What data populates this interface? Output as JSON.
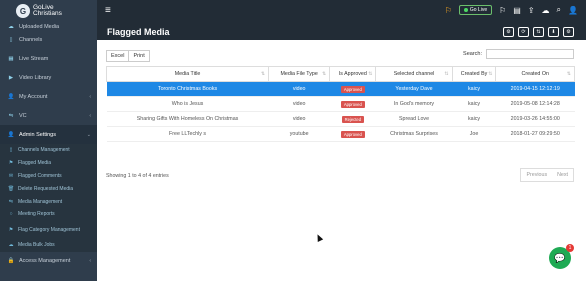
{
  "brand": {
    "logo_letter": "G",
    "line1": "GoLive",
    "line2": "Christians"
  },
  "sidebar": {
    "items": [
      {
        "label": "Uploaded Media",
        "icon": "cloud-upload-icon",
        "glyph": "☁"
      },
      {
        "label": "Channels",
        "icon": "file-icon",
        "glyph": "▯"
      },
      {
        "label": "Live Stream",
        "icon": "calendar-icon",
        "glyph": "▦"
      },
      {
        "label": "Video Library",
        "icon": "video-icon",
        "glyph": "▶"
      },
      {
        "label": "My Account",
        "icon": "user-icon",
        "glyph": "👤",
        "chevron": "‹"
      },
      {
        "label": "VC",
        "icon": "sliders-icon",
        "glyph": "⇋",
        "chevron": "‹"
      },
      {
        "label": "Admin Settings",
        "icon": "user-shield-icon",
        "glyph": "👤",
        "chevron": "⌄"
      }
    ],
    "submenu": [
      {
        "label": "Channels Management",
        "icon": "file-icon",
        "glyph": "▯"
      },
      {
        "label": "Flagged Media",
        "icon": "flag-icon",
        "glyph": "⚑"
      },
      {
        "label": "Flagged Comments",
        "icon": "comment-icon",
        "glyph": "✉"
      },
      {
        "label": "Delete Requested Media",
        "icon": "trash-icon",
        "glyph": "🗑"
      },
      {
        "label": "Media Management",
        "icon": "sliders-icon",
        "glyph": "⇋"
      },
      {
        "label": "Meeting Reports",
        "icon": "circle-icon",
        "glyph": "○"
      },
      {
        "label": "Flag Category Management",
        "icon": "flag-icon",
        "glyph": "⚑"
      },
      {
        "label": "Media Bulk Jobs",
        "icon": "cloud-icon",
        "glyph": "☁"
      }
    ],
    "footer_item": {
      "label": "Access Management",
      "icon": "lock-icon",
      "glyph": "🔒",
      "chevron": "‹"
    }
  },
  "topbar": {
    "menu_glyph": "≡",
    "golive_label": "Go Live",
    "icons": [
      {
        "name": "flag-icon",
        "glyph": "⚐"
      },
      {
        "name": "comment-icon",
        "glyph": "▤"
      },
      {
        "name": "upload-icon",
        "glyph": "⇪"
      },
      {
        "name": "cloud-icon",
        "glyph": "☁"
      },
      {
        "name": "search-icon",
        "glyph": "⌕"
      },
      {
        "name": "user-icon",
        "glyph": "👤"
      }
    ]
  },
  "page": {
    "title": "Flagged Media",
    "header_buttons": [
      {
        "name": "settings-icon",
        "glyph": "⚙"
      },
      {
        "name": "refresh-icon",
        "glyph": "⟳"
      },
      {
        "name": "filter-icon",
        "glyph": "⇅"
      },
      {
        "name": "download-icon",
        "glyph": "⬇"
      },
      {
        "name": "gear-icon",
        "glyph": "⚙"
      }
    ],
    "excel_label": "Excel",
    "print_label": "Print",
    "search_label": "Search:",
    "search_value": "",
    "table": {
      "columns": [
        "Media Title",
        "Media File Type",
        "Is Approved",
        "Selected channel",
        "Created By",
        "Created On"
      ],
      "rows": [
        [
          "Toronto Christmas Books",
          "video",
          "Approved",
          "Yesterday Dave",
          "kaicy",
          "2019-04-15 12:12:19"
        ],
        [
          "Who is Jesus",
          "video",
          "Approved",
          "In God's memory",
          "kaicy",
          "2019-05-08 12:14:28"
        ],
        [
          "Sharing Gifts With Homeless On Christmas",
          "video",
          "Rejected",
          "Spread Love",
          "kaicy",
          "2019-03-26 14:55:00"
        ],
        [
          "Free LLTechly s",
          "youtube",
          "Approved",
          "Christmas Surprises",
          "Joe",
          "2018-01-27 09:29:50"
        ]
      ],
      "selected_row": 0
    },
    "info": "Showing 1 to 4 of 4 entries",
    "prev_label": "Previous",
    "next_label": "Next"
  },
  "chat": {
    "glyph": "💬",
    "badge": "1"
  },
  "colors": {
    "sidebar": "#2f3d4c",
    "topbar": "#222c36",
    "selected": "#1e88e5",
    "badge": "#d9534f",
    "chat": "#1faa54"
  }
}
